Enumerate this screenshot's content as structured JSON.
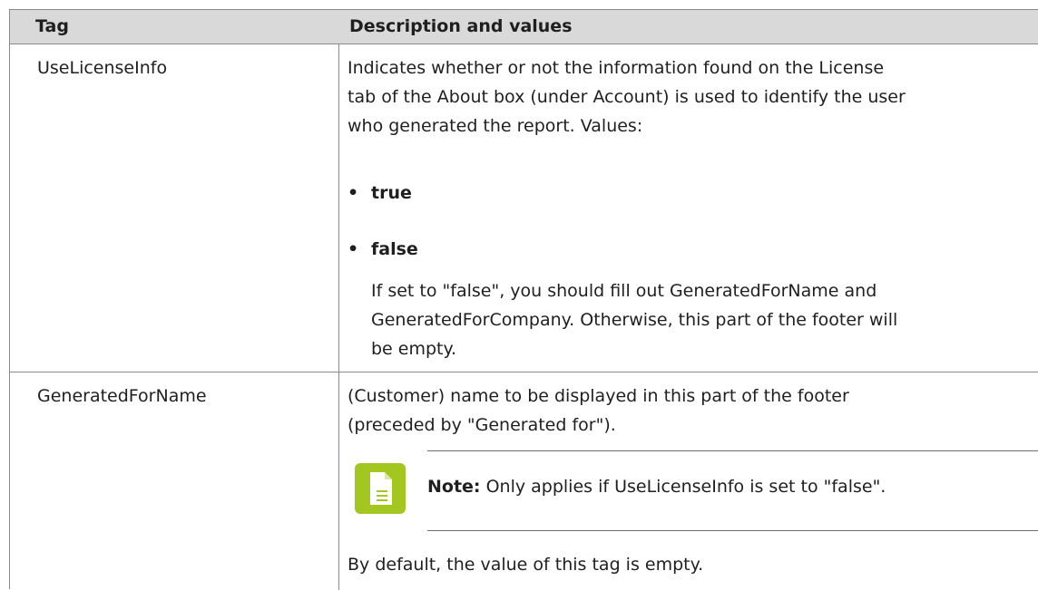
{
  "header": {
    "tag_label": "Tag",
    "desc_label": "Description and values"
  },
  "rows": [
    {
      "tag": "UseLicenseInfo",
      "description_lines": [
        "Indicates whether or not the information found on the License",
        "tab of the About box (under Account) is used to identify the user",
        "who generated the report. Values:"
      ],
      "values": [
        "true",
        "false"
      ],
      "followup_lines": [
        "If set to \"false\", you should fill out GeneratedForName and",
        "GeneratedForCompany. Otherwise, this part of the footer will",
        "be empty."
      ]
    },
    {
      "tag": "GeneratedForName",
      "description_lines": [
        "(Customer) name to be displayed in this part of the footer",
        "(preceded by \"Generated for\")."
      ],
      "note_label": "Note:",
      "note_text": "Only applies if UseLicenseInfo is set to \"false\".",
      "default_text": "By default, the value of this tag is empty."
    }
  ],
  "colors": {
    "header_bg": "#d9d9d9",
    "note_icon": "#a4c621",
    "border": "#8a8a8a"
  },
  "icons": {
    "note": "note-document-icon"
  }
}
